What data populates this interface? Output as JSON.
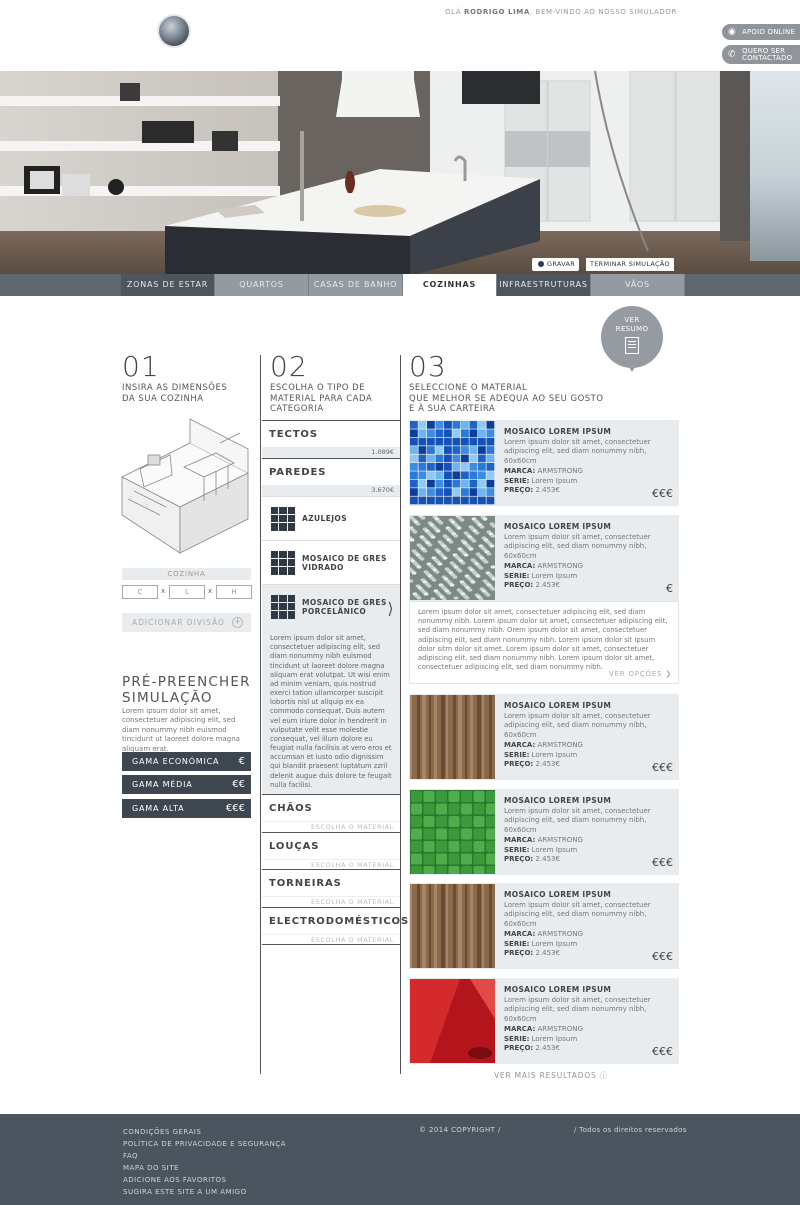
{
  "header": {
    "welcome_prefix": "OLÁ",
    "welcome_user": "RODRIGO LIMA",
    "welcome_suffix": ", BEM-VINDO AO NOSSO SIMULADOR",
    "support_online": "APOIO ONLINE",
    "contact_line1": "QUERO SER",
    "contact_line2": "CONTACTADO"
  },
  "hero": {
    "record_label": "GRAVAR",
    "end_label": "TERMINAR SIMULAÇÃO"
  },
  "nav": {
    "items": [
      {
        "label": "ZONAS DE ESTAR"
      },
      {
        "label": "QUARTOS"
      },
      {
        "label": "CASAS DE BANHO"
      },
      {
        "label": "COZINHAS"
      },
      {
        "label": "INFRAESTRUTURAS"
      },
      {
        "label": "VÃOS"
      }
    ],
    "selected": "COZINHAS"
  },
  "summary_bubble": {
    "line1": "VER",
    "line2": "RESUMO"
  },
  "step1": {
    "number": "01",
    "desc1": "INSIRA AS DIMENSÕES",
    "desc2": "DA SUA COZINHA",
    "room_label": "COZINHA",
    "dim_c": "C",
    "dim_l": "L",
    "dim_h": "H",
    "separator": "x",
    "add_division": "ADICIONAR DIVISÃO",
    "add_symbol": "+",
    "prefill_title1": "PRÉ-PREENCHER",
    "prefill_title2": "SIMULAÇÃO",
    "prefill_text": "Lorem ipsum dolor sit amet, consectetuer adipiscing elit, sed diam nonummy nibh euismod tincidunt ut laoreet dolore magna aliquam erat.",
    "ranges": [
      {
        "label": "GAMA ECONÓMICA",
        "euros": "€"
      },
      {
        "label": "GAMA MÉDIA",
        "euros": "€€"
      },
      {
        "label": "GAMA ALTA",
        "euros": "€€€"
      }
    ]
  },
  "step2": {
    "number": "02",
    "desc1": "ESCOLHA O TIPO DE",
    "desc2": "MATERIAL PARA CADA",
    "desc3": "CATEGORIA",
    "tectos": {
      "title": "TECTOS",
      "price": "1.089€"
    },
    "paredes": {
      "title": "PAREDES",
      "price": "3.670€"
    },
    "sub_items": [
      {
        "label": "AZULEJOS"
      },
      {
        "label1": "MOSAICO DE GRES",
        "label2": "VIDRADO"
      },
      {
        "label1": "MOSAICO DE GRES",
        "label2": "PORCELÂNICO"
      }
    ],
    "sub_desc": "Lorem ipsum dolor sit amet, consectetuer adipiscing elit, sed diam nonummy nibh euismod tincidunt ut laoreet dolore magna aliquam erat volutpat. Ut wisi enim ad minim veniam, quis nostrud exerci tation ullamcorper suscipit lobortis nisl ut aliquip ex ea commodo consequat. Duis autem vel eum iriure dolor in hendrerit in vulputate velit esse molestie consequat, vel illum dolore eu feugiat nulla facilisis at vero eros et accumsan et iusto odio dignissim qui blandit praesent luptatum zzril delenit augue duis dolore te feugait nulla facilisi.",
    "other_categories": [
      {
        "title": "CHÃOS",
        "hint": "ESCOLHA O MATERIAL"
      },
      {
        "title": "LOUÇAS",
        "hint": "ESCOLHA O MATERIAL"
      },
      {
        "title": "TORNEIRAS",
        "hint": "ESCOLHA O MATERIAL"
      },
      {
        "title": "ELECTRODOMÉSTICOS",
        "hint": "ESCOLHA O MATERIAL"
      }
    ]
  },
  "step3": {
    "number": "03",
    "desc1": "SELECCIONE O MATERIAL",
    "desc2": "QUE MELHOR SE ADEQUA AO SEU GOSTO",
    "desc3": "E À SUA CARTEIRA",
    "brand_label": "MARCA:",
    "series_label": "SERIE:",
    "price_label": "PREÇO:",
    "products": [
      {
        "name": "MOSAICO LOREM IPSUM",
        "desc": "Lorem ipsum dolor sit amet, consectetuer adipiscing elit, sed diam nonummy nibh, 60x60cm",
        "brand": "ARMSTRONG",
        "series": "Lorem Ipsum",
        "price": "2.453€",
        "euros": "€€€",
        "texture": "blue-mosaic"
      },
      {
        "name": "MOSAICO LOREM IPSUM",
        "desc": "Lorem ipsum dolor sit amet, consectetuer adipiscing elit, sed diam nonummy nibh, 60x60cm",
        "brand": "ARMSTRONG",
        "series": "Lorem Ipsum",
        "price": "2.453€",
        "euros": "€",
        "texture": "pebble-mosaic"
      },
      {
        "name": "MOSAICO LOREM IPSUM",
        "desc": "Lorem ipsum dolor sit amet, consectetuer adipiscing elit, sed diam nonummy nibh, 60x60cm",
        "brand": "ARMSTRONG",
        "series": "Lorem Ipsum",
        "price": "2.453€",
        "euros": "€€€",
        "texture": "wood"
      },
      {
        "name": "MOSAICO LOREM IPSUM",
        "desc": "Lorem ipsum dolor sit amet, consectetuer adipiscing elit, sed diam nonummy nibh, 60x60cm",
        "brand": "ARMSTRONG",
        "series": "Lorem Ipsum",
        "price": "2.453€",
        "euros": "€€€",
        "texture": "green-glass"
      },
      {
        "name": "MOSAICO LOREM IPSUM",
        "desc": "Lorem ipsum dolor sit amet, consectetuer adipiscing elit, sed diam nonummy nibh, 60x60cm",
        "brand": "ARMSTRONG",
        "series": "Lorem Ipsum",
        "price": "2.453€",
        "euros": "€€€",
        "texture": "wood"
      },
      {
        "name": "MOSAICO LOREM IPSUM",
        "desc": "Lorem ipsum dolor sit amet, consectetuer adipiscing elit, sed diam nonummy nibh, 60x60cm",
        "brand": "ARMSTRONG",
        "series": "Lorem Ipsum",
        "price": "2.453€",
        "euros": "€€€",
        "texture": "red-gloss"
      }
    ],
    "expanded_text": "Lorem ipsum dolor sit amet, consectetuer adipiscing elit, sed diam nonummy nibh. Lorem ipsum dolor sit amet, consectetuer adipiscing elit, sed diam nonummy nibh. Orem ipsum dolor sit amet, consectetuer adipiscing elit, sed diam nonummy nibh. Lorem ipsum dolor sit ipsum dolor sitm dolor sit amet. Lorem ipsum dolor sit amet, consectetuer adipiscing elit, sed diam nonummy nibh. Lorem ipsum dolor sit amet, consectetuer adipiscing elit, sed diam nonummy nibh.",
    "see_options": "VER OPÇÕES",
    "see_more": "VER MAIS RESULTADOS"
  },
  "footer": {
    "links": [
      "CONDIÇÕES GERAIS",
      "POLÍTICA DE PRIVACIDADE E SEGURANÇA",
      "FAQ",
      "MAPA DO SITE",
      "ADICIONE AOS FAVORITOS",
      "SUGIRA ESTE SITE A UM AMIGO"
    ],
    "copyright": "© 2014 COPYRIGHT /",
    "rights": "/ Todos os direitos reservados"
  },
  "colors": {
    "dark": "#3e4750",
    "panel": "#e9ecee",
    "footer": "#4b5560",
    "nav": "#939aa1"
  }
}
